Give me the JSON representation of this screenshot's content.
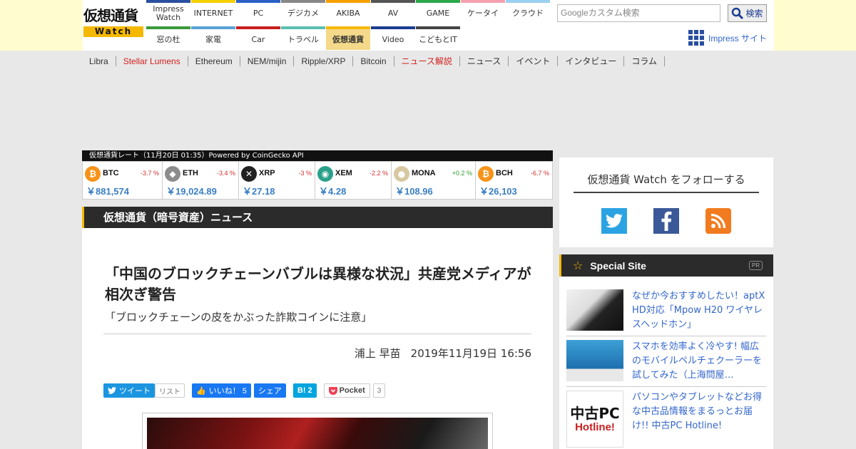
{
  "logo": {
    "line1": "仮想通貨",
    "line2": "Watch"
  },
  "nav": {
    "row1": [
      {
        "label": "Impress\nWatch",
        "color": "#2a4fa0"
      },
      {
        "label": "INTERNET",
        "color": "#f5d000"
      },
      {
        "label": "PC",
        "color": "#2a60c8"
      },
      {
        "label": "デジカメ",
        "color": "#888888"
      },
      {
        "label": "AKIBA",
        "color": "#f5a000"
      },
      {
        "label": "AV",
        "color": "#555555"
      },
      {
        "label": "GAME",
        "color": "#2aa84a"
      },
      {
        "label": "ケータイ",
        "color": "#f5a0b0"
      },
      {
        "label": "クラウド",
        "color": "#9ad0f0"
      }
    ],
    "row2": [
      {
        "label": "窓の杜",
        "color": "#3a9a3a"
      },
      {
        "label": "家電",
        "color": "#5aa0d8"
      },
      {
        "label": "Car",
        "color": "#c81e1e"
      },
      {
        "label": "トラベル",
        "color": "#5ac0b0"
      },
      {
        "label": "仮想通貨",
        "color": "#f5b800",
        "active": true
      },
      {
        "label": "Video",
        "color": "#1a3d8f"
      },
      {
        "label": "こどもとIT",
        "color": "#444444"
      }
    ]
  },
  "search": {
    "placeholder": "Googleカスタム検索",
    "button": "検索"
  },
  "impress_link": "Impress サイト",
  "subnav": [
    {
      "label": "Libra"
    },
    {
      "label": "Stellar Lumens",
      "red": true
    },
    {
      "label": "Ethereum"
    },
    {
      "label": "NEM/mijin"
    },
    {
      "label": "Ripple/XRP"
    },
    {
      "label": "Bitcoin"
    },
    {
      "label": "ニュース解説",
      "red": true
    },
    {
      "label": "ニュース"
    },
    {
      "label": "イベント"
    },
    {
      "label": "インタビュー"
    },
    {
      "label": "コラム"
    }
  ],
  "rates": {
    "header": "仮想通貨レート（11月20日 01:35）Powered by CoinGecko API",
    "coins": [
      {
        "symbol": "BTC",
        "change": "-3.7 %",
        "dir": "neg",
        "price": "￥881,574",
        "icon": "bitcoin-icon",
        "color": "#f7931a",
        "glyph": "₿"
      },
      {
        "symbol": "ETH",
        "change": "-3.4 %",
        "dir": "neg",
        "price": "￥19,024.89",
        "icon": "ethereum-icon",
        "color": "#8c8c8c",
        "glyph": "◆"
      },
      {
        "symbol": "XRP",
        "change": "-3 %",
        "dir": "neg",
        "price": "￥27.18",
        "icon": "xrp-icon",
        "color": "#222222",
        "glyph": "✕"
      },
      {
        "symbol": "XEM",
        "change": "-2.2 %",
        "dir": "neg",
        "price": "￥4.28",
        "icon": "nem-icon",
        "color": "#2aa08a",
        "glyph": "◉"
      },
      {
        "symbol": "MONA",
        "change": "+0.2 %",
        "dir": "pos",
        "price": "￥108.96",
        "icon": "monacoin-icon",
        "color": "#d8c8a0",
        "glyph": "●"
      },
      {
        "symbol": "BCH",
        "change": "-6.7 %",
        "dir": "neg",
        "price": "￥26,103",
        "icon": "bitcoin-cash-icon",
        "color": "#f7931a",
        "glyph": "₿"
      }
    ]
  },
  "section_title": "仮想通貨（暗号資産）ニュース",
  "article": {
    "headline": "「中国のブロックチェーンバブルは異様な状況」共産党メディアが相次ぎ警告",
    "subhead": "「ブロックチェーンの皮をかぶった詐欺コインに注意」",
    "author": "浦上 早苗",
    "date": "2019年11月19日 16:56"
  },
  "share": {
    "tweet": "ツイート",
    "list": "リスト",
    "like": "いいね！ 5",
    "fb_share": "シェア",
    "hatena": "B! 2",
    "pocket": "Pocket",
    "pocket_count": "3"
  },
  "follow": {
    "title": "仮想通貨 Watch をフォローする"
  },
  "special": {
    "title": "Special Site",
    "pr": "PR",
    "items": [
      {
        "text": "なぜか今おすすめしたい！aptX HD対応「Mpow H20 ワイヤレスヘッドホン」"
      },
      {
        "text": "スマホを効率よく冷やす! 幅広のモバイルペルチェクーラーを試してみた（上海問屋…"
      },
      {
        "text": "パソコンやタブレットなどお得な中古品情報をまるっとお届け!! 中古PC Hotline!",
        "thumb_a": "中古PC",
        "thumb_b": "Hotline!"
      }
    ]
  }
}
